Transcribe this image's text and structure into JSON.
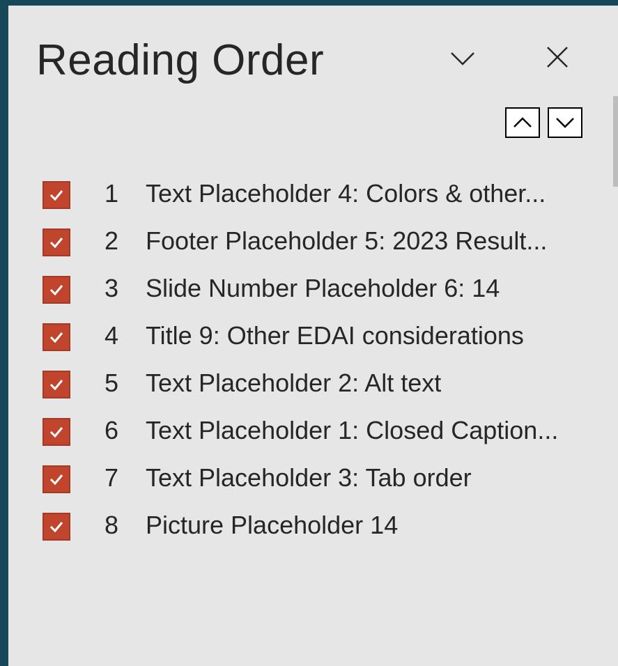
{
  "pane": {
    "title": "Reading Order",
    "options_icon": "chevron-down-icon",
    "close_icon": "close-icon",
    "move_up_icon": "chevron-up-icon",
    "move_down_icon": "chevron-down-icon",
    "accent_color": "#c1452d",
    "background_color": "#e6e6e6",
    "frame_color": "#17485a"
  },
  "items": [
    {
      "num": "1",
      "label": "Text Placeholder 4: Colors & other...",
      "checked": true
    },
    {
      "num": "2",
      "label": "Footer Placeholder 5: 2023 Result...",
      "checked": true
    },
    {
      "num": "3",
      "label": "Slide Number Placeholder 6: 14",
      "checked": true
    },
    {
      "num": "4",
      "label": "Title 9: Other EDAI considerations",
      "checked": true
    },
    {
      "num": "5",
      "label": "Text Placeholder 2: Alt text",
      "checked": true
    },
    {
      "num": "6",
      "label": "Text Placeholder 1: Closed Caption...",
      "checked": true
    },
    {
      "num": "7",
      "label": "Text Placeholder 3: Tab order",
      "checked": true
    },
    {
      "num": "8",
      "label": "Picture Placeholder 14",
      "checked": true
    }
  ]
}
